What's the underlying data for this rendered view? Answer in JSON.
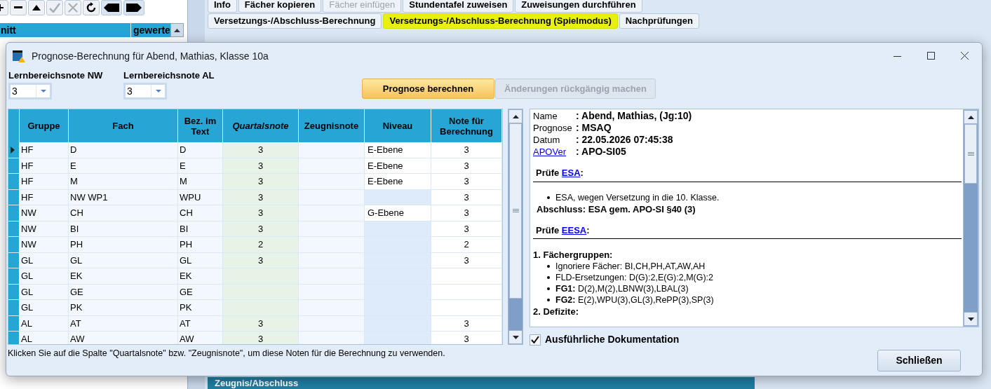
{
  "background": {
    "left_toolbar": [
      {
        "kind": "add",
        "disabled": false
      },
      {
        "kind": "remove",
        "disabled": false
      },
      {
        "kind": "up",
        "disabled": false
      },
      {
        "kind": "check",
        "disabled": true
      },
      {
        "kind": "cancel",
        "disabled": true
      },
      {
        "kind": "refresh",
        "disabled": false
      },
      {
        "kind": "back",
        "disabled": false
      },
      {
        "kind": "forward",
        "disabled": false
      }
    ],
    "left_table_columns": [
      "nitt",
      "gewerte"
    ],
    "tab_rows": [
      [
        {
          "label": "Info",
          "selected": false,
          "disabled": false
        },
        {
          "label": "Fächer kopieren",
          "selected": false,
          "disabled": false
        },
        {
          "label": "Fächer einfügen",
          "selected": false,
          "disabled": true
        },
        {
          "label": "Stundentafel zuweisen",
          "selected": false,
          "disabled": false
        },
        {
          "label": "Zuweisungen durchführen",
          "selected": false,
          "disabled": false
        }
      ],
      [
        {
          "label": "Versetzungs-/Abschluss-Berechnung",
          "selected": false,
          "disabled": false
        },
        {
          "label": "Versetzungs-/Abschluss-Berechnung (Spielmodus)",
          "selected": true,
          "disabled": false
        },
        {
          "label": "Nachprüfungen",
          "selected": false,
          "disabled": false
        }
      ]
    ],
    "bottom_tab": "Zeugnis/Abschluss"
  },
  "dialog": {
    "title": "Prognose-Berechnung für Abend, Mathias, Klasse 10a",
    "selects": [
      {
        "label": "Lernbereichsnote NW",
        "value": "3"
      },
      {
        "label": "Lernbereichsnote AL",
        "value": "3"
      }
    ],
    "buttons": [
      {
        "label": "Prognose berechnen",
        "disabled": false
      },
      {
        "label": "Änderungen rückgängig machen",
        "disabled": true
      }
    ],
    "table": {
      "columns": [
        {
          "label": "Gruppe",
          "kind": "text"
        },
        {
          "label": "Fach",
          "kind": "text"
        },
        {
          "label": "Bez. im Text",
          "kind": "text"
        },
        {
          "label": "Quartalsnote",
          "kind": "source"
        },
        {
          "label": "Zeugnisnote",
          "kind": "plain"
        },
        {
          "label": "Niveau",
          "kind": "level"
        },
        {
          "label": "Note für Berechnung",
          "kind": "result"
        }
      ],
      "rows": [
        {
          "selected": true,
          "cells": [
            "HF",
            "D",
            "D",
            "3",
            null,
            "E-Ebene",
            "3"
          ]
        },
        {
          "selected": false,
          "cells": [
            "HF",
            "E",
            "E",
            "3",
            null,
            "E-Ebene",
            "3"
          ]
        },
        {
          "selected": false,
          "cells": [
            "HF",
            "M",
            "M",
            "3",
            null,
            "E-Ebene",
            "3"
          ]
        },
        {
          "selected": false,
          "cells": [
            "HF",
            "NW WP1",
            "WPU",
            "3",
            null,
            null,
            "3"
          ]
        },
        {
          "selected": false,
          "cells": [
            "NW",
            "CH",
            "CH",
            "3",
            null,
            "G-Ebene",
            "3"
          ]
        },
        {
          "selected": false,
          "cells": [
            "NW",
            "BI",
            "BI",
            "3",
            null,
            null,
            "3"
          ]
        },
        {
          "selected": false,
          "cells": [
            "NW",
            "PH",
            "PH",
            "2",
            null,
            null,
            "2"
          ]
        },
        {
          "selected": false,
          "cells": [
            "GL",
            "GL",
            "GL",
            "3",
            null,
            null,
            "3"
          ]
        },
        {
          "selected": false,
          "cells": [
            "GL",
            "EK",
            "EK",
            null,
            null,
            null,
            null
          ]
        },
        {
          "selected": false,
          "cells": [
            "GL",
            "GE",
            "GE",
            null,
            null,
            null,
            null
          ]
        },
        {
          "selected": false,
          "cells": [
            "GL",
            "PK",
            "PK",
            null,
            null,
            null,
            null
          ]
        },
        {
          "selected": false,
          "cells": [
            "AL",
            "AT",
            "AT",
            "3",
            null,
            null,
            "3"
          ]
        },
        {
          "selected": false,
          "cells": [
            "AL",
            "AW",
            "AW",
            "3",
            null,
            null,
            "3"
          ]
        }
      ]
    },
    "report": [
      {
        "kind": "field",
        "label": "Name",
        "value": ": Abend, Mathias, (Jg:10)",
        "link": false
      },
      {
        "kind": "field",
        "label": "Prognose",
        "value": ": MSAQ",
        "link": false
      },
      {
        "kind": "field",
        "label": "Datum",
        "value": ": 22.05.2026 07:45:38",
        "link": false
      },
      {
        "kind": "field",
        "label": "APOVer",
        "value": ": APO-SI05",
        "link": true
      },
      {
        "kind": "check",
        "prefix": "Prüfe",
        "link": "ESA",
        "suffix": ":"
      },
      {
        "kind": "bullet",
        "text": "ESA, wegen Versetzung in die 10. Klasse."
      },
      {
        "kind": "result",
        "text": "Abschluss: ESA gem. APO-SI §40 (3)"
      },
      {
        "kind": "check",
        "prefix": "Prüfe",
        "link": "EESA",
        "suffix": ":"
      },
      {
        "kind": "section",
        "text": "1. Fächergruppen:"
      },
      {
        "kind": "bullet",
        "text": "Ignoriere Fächer: BI,CH,PH,AT,AW,AH"
      },
      {
        "kind": "bullet",
        "text": "FLD-Ersetzungen: D(G):2,E(G):2,M(G):2"
      },
      {
        "kind": "bullet",
        "text": "**FG1:** D(2),M(2),LBNW(3),LBAL(3)"
      },
      {
        "kind": "bullet",
        "text": "**FG2:** E(2),WPU(3),GL(3),RePP(3),SP(3)"
      },
      {
        "kind": "section",
        "text": "2. Defizite:"
      }
    ],
    "detail_checkbox": {
      "label": "Ausführliche Dokumentation",
      "checked": true
    },
    "hint": "Klicken Sie auf die Spalte \"Quartalsnote\" bzw. \"Zeugnisnote\", um diese Noten für die Berechnung zu verwenden.",
    "close_button": "Schließen"
  }
}
